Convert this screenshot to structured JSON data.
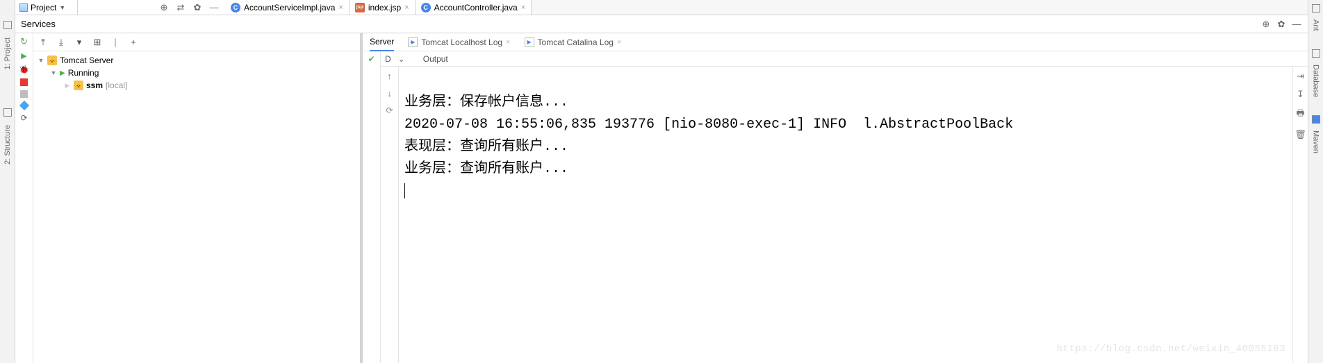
{
  "top": {
    "project_label": "Project",
    "tabs": [
      {
        "icon": "C",
        "icon_class": "c",
        "name": "AccountServiceImpl.java"
      },
      {
        "icon": "jsp",
        "icon_class": "jsp",
        "name": "index.jsp"
      },
      {
        "icon": "C",
        "icon_class": "c",
        "name": "AccountController.java"
      }
    ]
  },
  "services": {
    "title": "Services",
    "tree": {
      "root": "Tomcat Server",
      "running": "Running",
      "app_name": "ssm",
      "app_scope": "[local]"
    }
  },
  "right_gutter": {
    "ant": "Ant",
    "database": "Database",
    "maven": "Maven"
  },
  "left_gutter": {
    "project": "1: Project",
    "structure": "2: Structure"
  },
  "server": {
    "tabs": {
      "server": "Server",
      "localhost": "Tomcat Localhost Log",
      "catalina": "Tomcat Catalina Log"
    },
    "debug_label": "D",
    "output_label": "Output",
    "console_lines": [
      "业务层：保存帐户信息...",
      "2020-07-08 16:55:06,835 193776 [nio-8080-exec-1] INFO  l.AbstractPoolBack",
      "表现层：查询所有账户...",
      "业务层：查询所有账户..."
    ]
  },
  "watermark": "https://blog.csdn.net/weixin_40055163"
}
